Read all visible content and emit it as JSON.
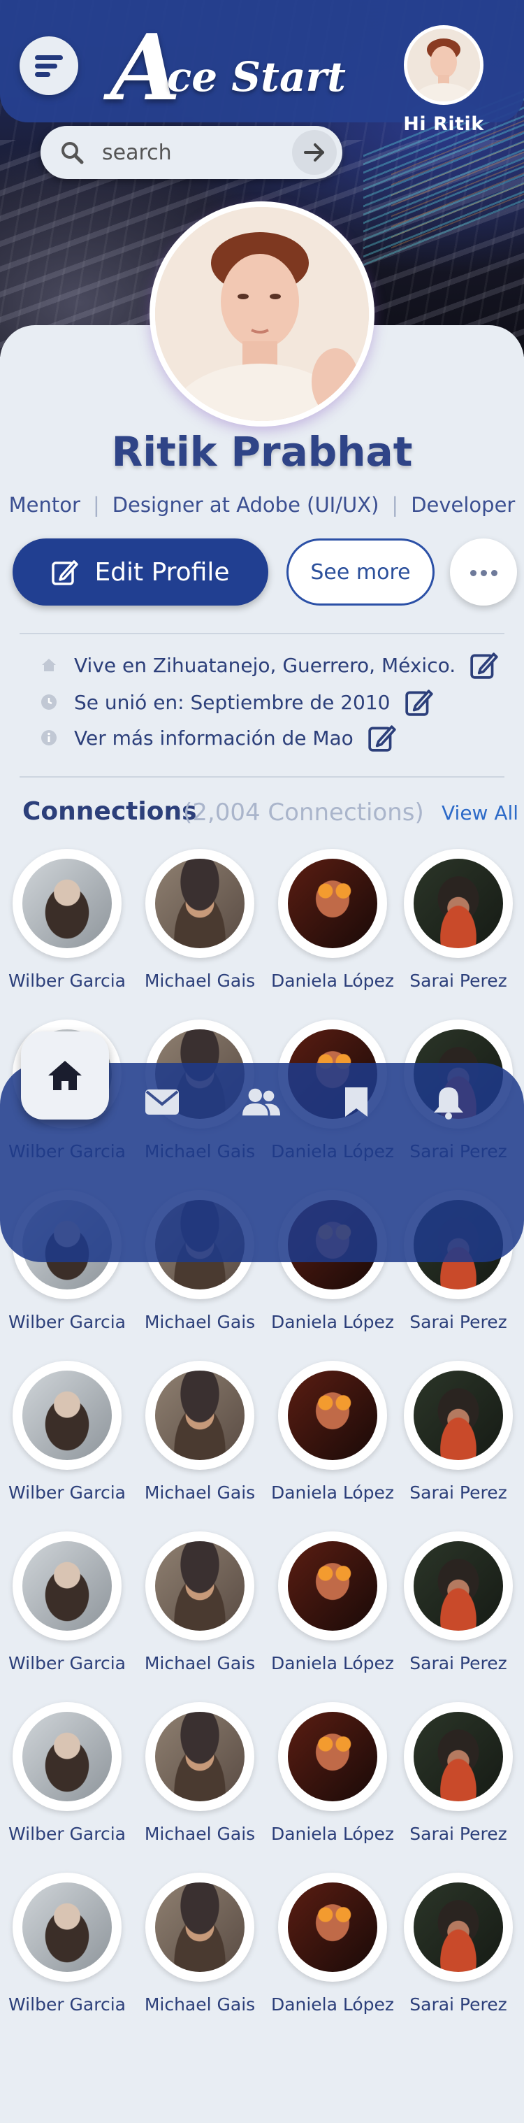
{
  "header": {
    "logo_big": "A",
    "logo_rest": "ce Start",
    "greeting": "Hi Ritik",
    "search_placeholder": "search"
  },
  "profile": {
    "name": "Ritik Prabhat",
    "roles": [
      "Mentor",
      "Designer at Adobe (UI/UX)",
      "Developer"
    ],
    "edit_label": "Edit Profile",
    "see_more_label": "See more"
  },
  "info": [
    {
      "icon": "home-icon",
      "text": "Vive en Zihuatanejo, Guerrero, México."
    },
    {
      "icon": "clock-icon",
      "text": "Se unió en: Septiembre de 2010"
    },
    {
      "icon": "info-icon",
      "text": "Ver más información de Mao"
    }
  ],
  "connections": {
    "title": "Connections",
    "count": "(2,004 Connections)",
    "view_all": "View All",
    "people": [
      {
        "name": "Wilber Garcia",
        "photo": "p1"
      },
      {
        "name": "Michael Gais",
        "photo": "p2"
      },
      {
        "name": "Daniela López",
        "photo": "p3"
      },
      {
        "name": "Sarai Perez",
        "photo": "p4"
      },
      {
        "name": "Wilber Garcia",
        "photo": "p1"
      },
      {
        "name": "Michael Gais",
        "photo": "p2"
      },
      {
        "name": "Daniela López",
        "photo": "p3"
      },
      {
        "name": "Sarai Perez",
        "photo": "p4"
      },
      {
        "name": "Wilber Garcia",
        "photo": "p1"
      },
      {
        "name": "Michael Gais",
        "photo": "p2"
      },
      {
        "name": "Daniela López",
        "photo": "p3"
      },
      {
        "name": "Sarai Perez",
        "photo": "p4"
      },
      {
        "name": "Wilber Garcia",
        "photo": "p1"
      },
      {
        "name": "Michael Gais",
        "photo": "p2"
      },
      {
        "name": "Daniela López",
        "photo": "p3"
      },
      {
        "name": "Sarai Perez",
        "photo": "p4"
      },
      {
        "name": "Wilber Garcia",
        "photo": "p1"
      },
      {
        "name": "Michael Gais",
        "photo": "p2"
      },
      {
        "name": "Daniela López",
        "photo": "p3"
      },
      {
        "name": "Sarai Perez",
        "photo": "p4"
      },
      {
        "name": "Wilber Garcia",
        "photo": "p1"
      },
      {
        "name": "Michael Gais",
        "photo": "p2"
      },
      {
        "name": "Daniela López",
        "photo": "p3"
      },
      {
        "name": "Sarai Perez",
        "photo": "p4"
      },
      {
        "name": "Wilber Garcia",
        "photo": "p1"
      },
      {
        "name": "Michael Gais",
        "photo": "p2"
      },
      {
        "name": "Daniela López",
        "photo": "p3"
      },
      {
        "name": "Sarai Perez",
        "photo": "p4"
      }
    ]
  },
  "nav": {
    "items": [
      "home-icon",
      "mail-icon",
      "users-icon",
      "bookmark-icon",
      "bell-icon"
    ],
    "active": "home-icon"
  },
  "colors": {
    "primary": "#213f91",
    "text": "#2c3f7a",
    "muted": "#aab5cb",
    "link": "#2c6ac8",
    "background": "#e8edf3"
  }
}
